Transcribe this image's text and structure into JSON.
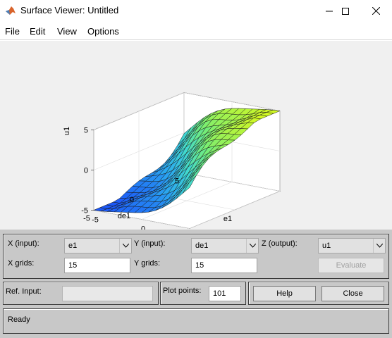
{
  "window": {
    "title": "Surface Viewer: Untitled",
    "minimize": "—",
    "maximize": "☐",
    "close": "✕"
  },
  "menu": [
    "File",
    "Edit",
    "View",
    "Options"
  ],
  "plot": {
    "zlabel": "u1",
    "xlabel": "e1",
    "ylabel": "de1",
    "zticks": [
      "5",
      "0",
      "-5"
    ],
    "xticks": [
      "-5",
      "0",
      "5"
    ],
    "yticks": [
      "5",
      "0",
      "-5"
    ],
    "colormap": [
      "#1c58f8",
      "#2aa6f0",
      "#41d8cf",
      "#76ee75",
      "#d0f724"
    ]
  },
  "chart_data": {
    "type": "surface",
    "title": "",
    "xlabel": "e1",
    "ylabel": "de1",
    "zlabel": "u1",
    "xlim": [
      -5,
      5
    ],
    "ylim": [
      -5,
      5
    ],
    "zlim": [
      -5,
      5
    ],
    "grid": "on",
    "grid_points": 15,
    "description_values": {
      "z_at_e1_min_de1_min": -5,
      "z_at_e1_max_de1_max": 5,
      "z_at_e1_max_de1_min": 0,
      "z_at_e1_min_de1_max": 0
    }
  },
  "controls": {
    "x_input_label": "X (input):",
    "x_input_value": "e1",
    "y_input_label": "Y (input):",
    "y_input_value": "de1",
    "z_output_label": "Z (output):",
    "z_output_value": "u1",
    "x_grids_label": "X grids:",
    "x_grids_value": "15",
    "y_grids_label": "Y grids:",
    "y_grids_value": "15",
    "evaluate_label": "Evaluate",
    "ref_input_label": "Ref. Input:",
    "ref_input_value": "",
    "plot_points_label": "Plot points:",
    "plot_points_value": "101",
    "help_label": "Help",
    "close_label": "Close"
  },
  "status": "Ready"
}
